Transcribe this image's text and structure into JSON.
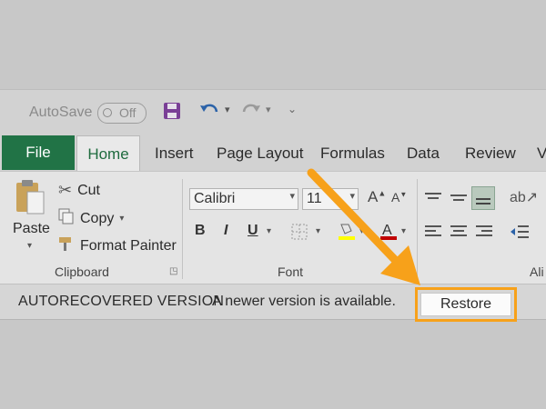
{
  "qat": {
    "autosave_label": "AutoSave",
    "autosave_state": "Off",
    "icons": [
      "save-icon",
      "undo-icon",
      "redo-icon",
      "customize-qat-icon"
    ]
  },
  "tabs": [
    "File",
    "Home",
    "Insert",
    "Page Layout",
    "Formulas",
    "Data",
    "Review",
    "V"
  ],
  "clipboard": {
    "paste": "Paste",
    "cut": "Cut",
    "copy": "Copy",
    "format_painter": "Format Painter",
    "group_label": "Clipboard"
  },
  "font": {
    "name": "Calibri",
    "size": "11",
    "bold": "B",
    "italic": "I",
    "underline": "U",
    "grow": "A",
    "shrink": "A",
    "font_color": "A",
    "group_label": "Font"
  },
  "alignment": {
    "group_label": "Ali"
  },
  "recovery_bar": {
    "title": "AUTORECOVERED VERSION",
    "message": "A newer version is available.",
    "restore_label": "Restore"
  },
  "colors": {
    "file_tab": "#217346",
    "accent_highlight": "#f7a11a",
    "font_color_bar": "#c00000",
    "highlight_bar": "#ffff00"
  }
}
